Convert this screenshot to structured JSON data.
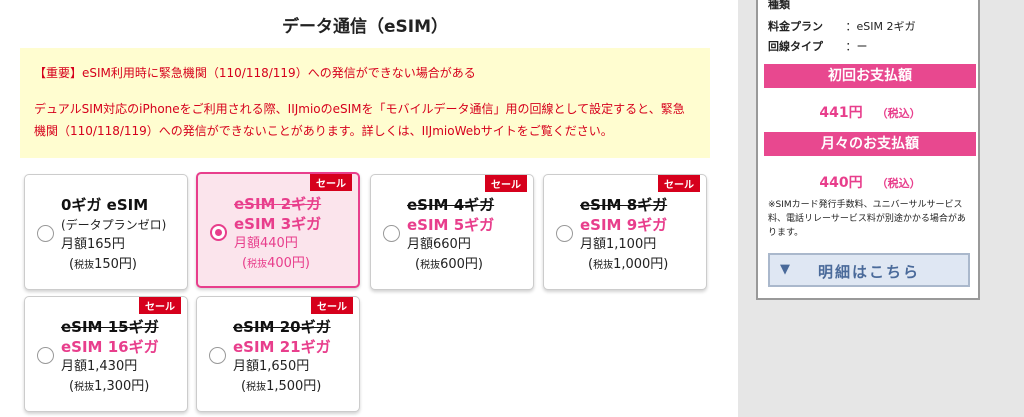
{
  "section": {
    "title": "データ通信（eSIM）"
  },
  "notice": {
    "heading": "【重要】eSIM利用時に緊急機関（110/118/119）への発信ができない場合がある",
    "body": "デュアルSIM対応のiPhoneをご利用される際、IIJmioのeSIMを「モバイルデータ通信」用の回線として設定すると、緊急機関（110/118/119）への発信ができないことがあります。詳しくは、IIJmioWebサイトをご覧ください。"
  },
  "plans": [
    {
      "name": "0ギガ eSIM",
      "sub": "(データプランゼロ)",
      "price": "月額165円",
      "tax_label": "税抜",
      "tax_value": "150円"
    },
    {
      "sale": "セール",
      "old": "eSIM 2ギガ",
      "new": "eSIM 3ギガ",
      "price": "月額440円",
      "tax_label": "税抜",
      "tax_value": "400円"
    },
    {
      "sale": "セール",
      "old": "eSIM 4ギガ",
      "new": "eSIM 5ギガ",
      "price": "月額660円",
      "tax_label": "税抜",
      "tax_value": "600円"
    },
    {
      "sale": "セール",
      "old": "eSIM 8ギガ",
      "new": "eSIM 9ギガ",
      "price": "月額1,100円",
      "tax_label": "税抜",
      "tax_value": "1,000円"
    },
    {
      "sale": "セール",
      "old": "eSIM 15ギガ",
      "new": "eSIM 16ギガ",
      "price": "月額1,430円",
      "tax_label": "税抜",
      "tax_value": "1,300円"
    },
    {
      "sale": "セール",
      "old": "eSIM 20ギガ",
      "new": "eSIM 21ギガ",
      "price": "月額1,650円",
      "tax_label": "税抜",
      "tax_value": "1,500円"
    }
  ],
  "selected_plan": "eSIM 3ギガ",
  "summary": {
    "type_label": "種類",
    "plan_label": "料金プラン",
    "plan_value": "：eSIM 2ギガ",
    "line_label": "回線タイプ",
    "line_value": "：ー",
    "initial_title": "初回お支払額",
    "initial_amount": "441円",
    "initial_tax": "（税込）",
    "monthly_title": "月々のお支払額",
    "monthly_amount": "440円",
    "monthly_tax": "（税込）",
    "note": "※SIMカード発行手数料、ユニバーサルサービス料、電話リレーサービス料が別途かかる場合があります。"
  },
  "detail_button": {
    "label": "明細はこちら",
    "icon": "chevron-down-icon"
  },
  "colors": {
    "accent_pink": "#e83e8c",
    "sale_red": "#d6001c",
    "notice_bg": "#fffdd0",
    "notice_text": "#d6001c"
  }
}
